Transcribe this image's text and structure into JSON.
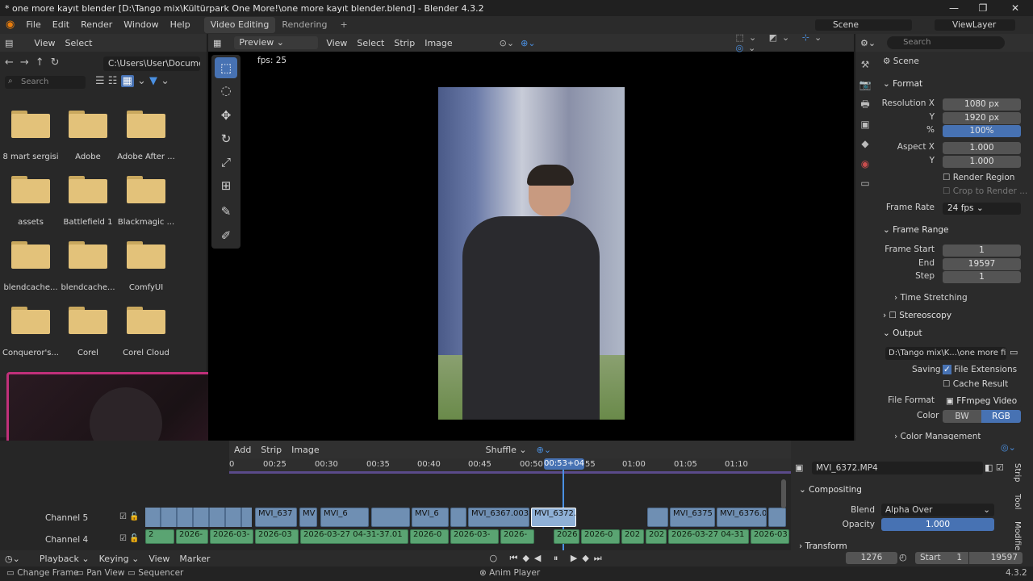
{
  "window": {
    "title": "* one more kayıt blender [D:\\Tango mix\\Kültürpark One More!\\one more kayıt blender.blend] - Blender 4.3.2"
  },
  "menu": {
    "items": [
      "File",
      "Edit",
      "Render",
      "Window",
      "Help"
    ],
    "workspaces": [
      "Video Editing",
      "Rendering"
    ],
    "add_workspace": "+",
    "scene": "Scene",
    "view_layer": "ViewLayer"
  },
  "file_browser": {
    "header": [
      "View",
      "Select"
    ],
    "path": "C:\\Users\\User\\Docume...",
    "search_placeholder": "Search",
    "folders": [
      "8 mart sergisi",
      "Adobe",
      "Adobe After ...",
      "assets",
      "Battlefield 1",
      "Blackmagic ...",
      "blendcache...",
      "blendcache...",
      "ComfyUI",
      "Conqueror's...",
      "Corel",
      "Corel Cloud"
    ]
  },
  "preview": {
    "mode": "Preview",
    "menu": [
      "View",
      "Select",
      "Strip",
      "Image"
    ],
    "fps_label": "fps: 25"
  },
  "properties": {
    "search_placeholder": "Search",
    "scene_label": "Scene",
    "format": {
      "title": "Format",
      "res_x_label": "Resolution X",
      "res_x": "1080 px",
      "res_y_label": "Y",
      "res_y": "1920 px",
      "pct_label": "%",
      "pct": "100%",
      "aspect_x_label": "Aspect X",
      "aspect_x": "1.000",
      "aspect_y_label": "Y",
      "aspect_y": "1.000",
      "render_region": "Render Region",
      "crop": "Crop to Render ...",
      "frame_rate_label": "Frame Rate",
      "frame_rate": "24 fps"
    },
    "frame_range": {
      "title": "Frame Range",
      "start_label": "Frame Start",
      "start": "1",
      "end_label": "End",
      "end": "19597",
      "step_label": "Step",
      "step": "1",
      "time_stretching": "Time Stretching"
    },
    "stereoscopy": "Stereoscopy",
    "output": {
      "title": "Output",
      "path": "D:\\Tango mix\\K...\\one more final",
      "saving_label": "Saving",
      "file_ext": "File Extensions",
      "cache_result": "Cache Result",
      "file_format_label": "File Format",
      "file_format": "FFmpeg Video",
      "color_label": "Color",
      "color_bw": "BW",
      "color_rgb": "RGB",
      "color_management": "Color Management"
    }
  },
  "sequencer": {
    "menu": [
      "Add",
      "Strip",
      "Image"
    ],
    "snap": "Shuffle",
    "playhead": "00:53+04",
    "ticks": [
      "0",
      "00:25",
      "00:30",
      "00:35",
      "00:40",
      "00:45",
      "00:50",
      "55",
      "01:00",
      "01:05",
      "01:10"
    ],
    "channels": [
      "Channel 5",
      "Channel 4"
    ],
    "video_strips": [
      "MVI_637",
      "MV",
      "MVI_6",
      "MVI_6",
      "MVI_6367.003",
      "MVI_6372.",
      "MVI_6375",
      "MVI_6376.0"
    ],
    "audio_strips": [
      "2",
      "2026-",
      "2026-03-",
      "2026-03",
      "2026-03-27 04-31-37.01",
      "2026-0",
      "2026-03-",
      "2026-",
      "2026",
      "2026-0",
      "202",
      "202",
      "2026-03-27 04-31",
      "2026-03"
    ]
  },
  "strip_panel": {
    "name": "MVI_6372.MP4",
    "compositing": "Compositing",
    "blend_label": "Blend",
    "blend": "Alpha Over",
    "opacity_label": "Opacity",
    "opacity": "1.000",
    "transform": "Transform",
    "tabs": [
      "Strip",
      "Tool",
      "Modifie"
    ]
  },
  "timeline": {
    "menu": [
      "Playback",
      "Keying",
      "View",
      "Marker"
    ],
    "current_frame": "1276",
    "start_label": "Start",
    "start": "1",
    "end": "19597"
  },
  "status": {
    "change_frame": "Change Frame",
    "pan_view": "Pan View",
    "sequencer": "Sequencer",
    "anim_player": "Anim Player",
    "version": "4.3.2"
  },
  "colors": {
    "accent": "#4772b3",
    "bg": "#1d1d1d",
    "panel": "#282828",
    "video_strip": "#6f8fb3",
    "audio_strip": "#5aa472"
  }
}
